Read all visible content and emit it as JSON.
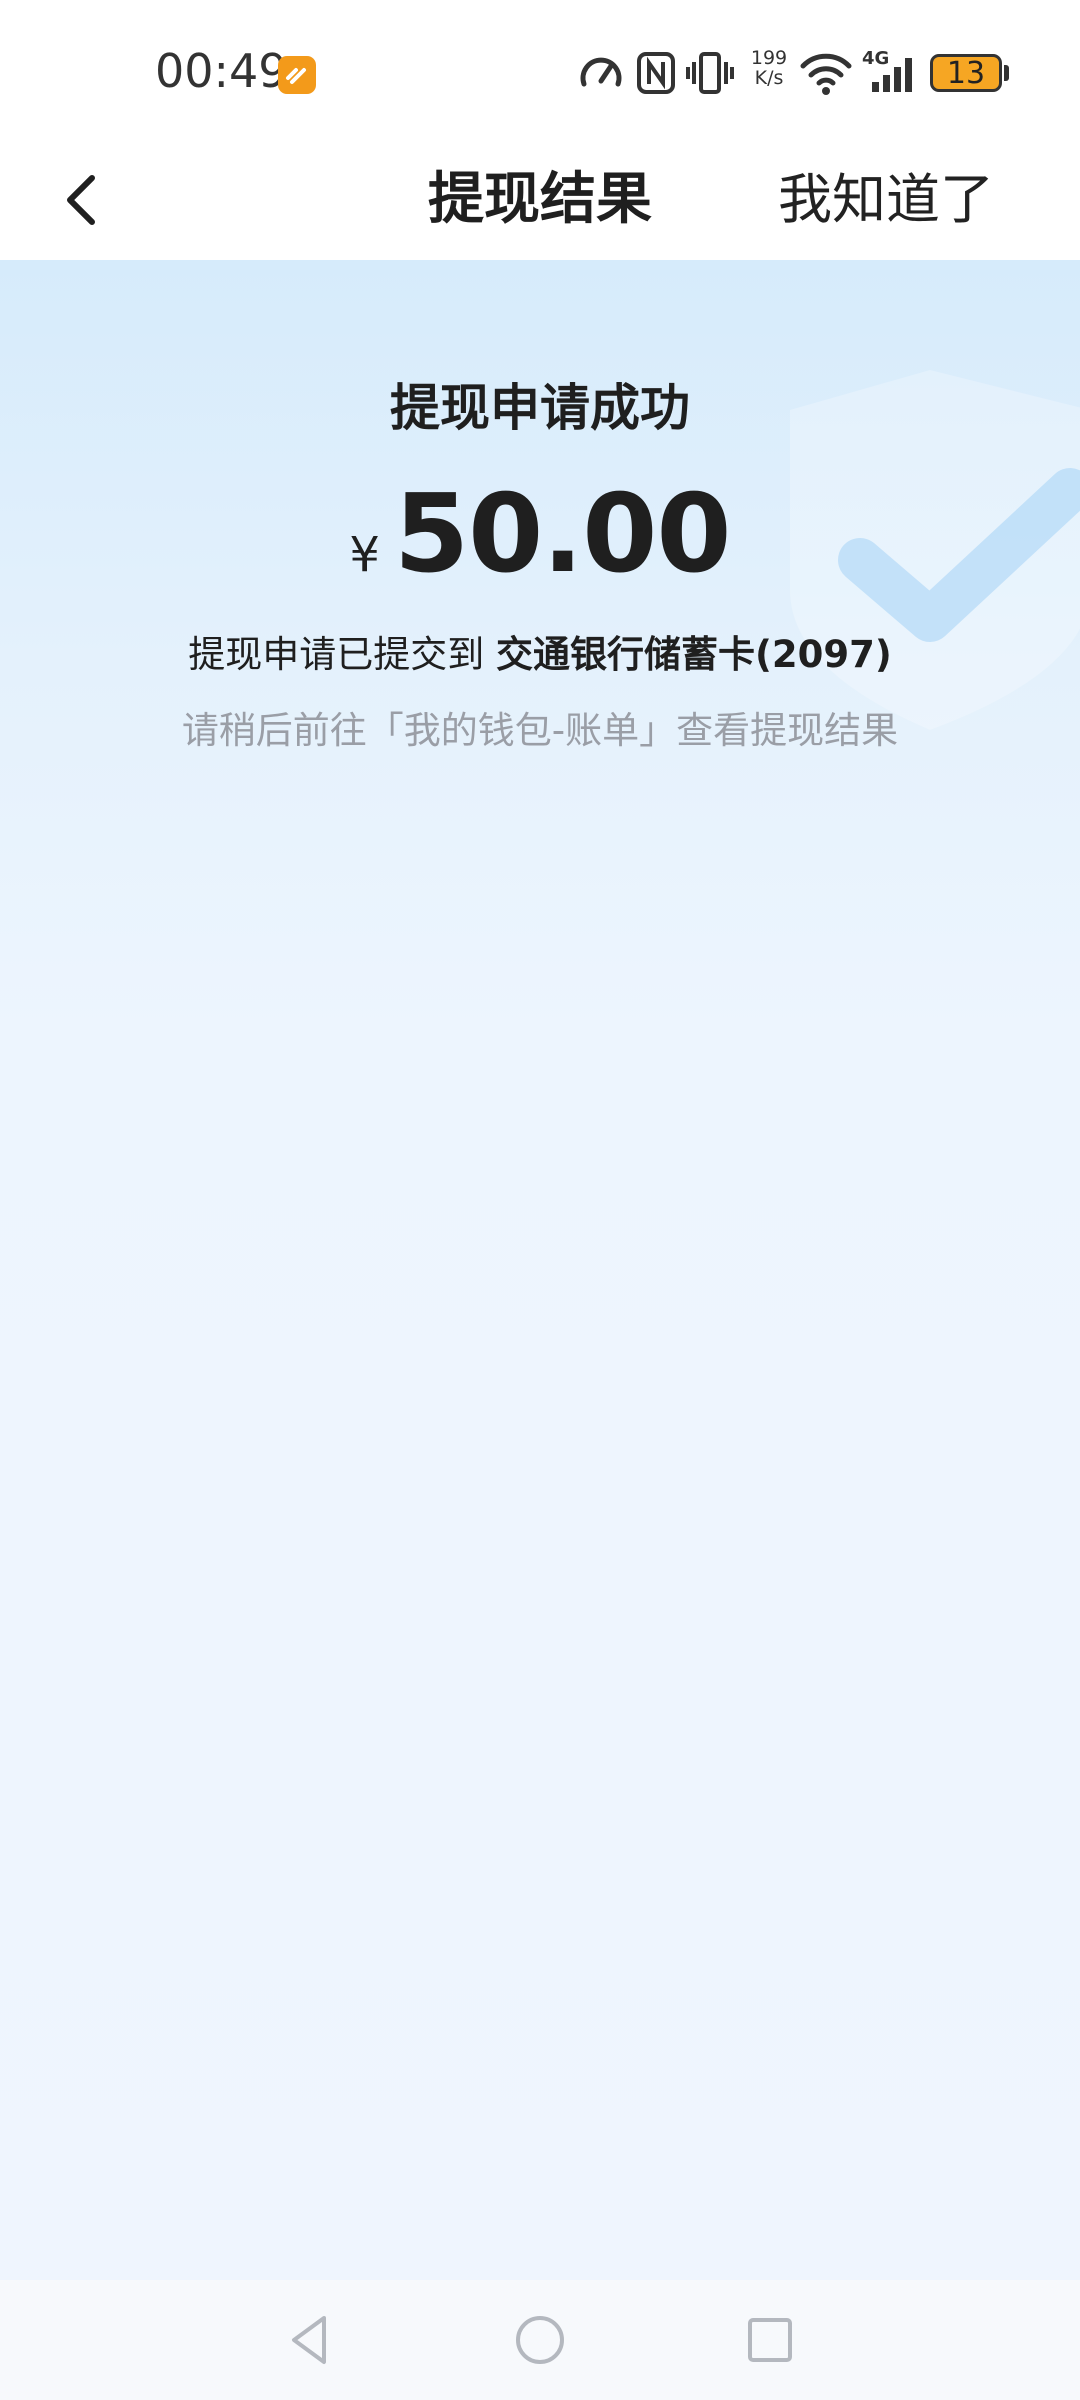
{
  "status_bar": {
    "time": "00:49",
    "net_speed_value": "199",
    "net_speed_unit": "K/s",
    "network": "4G",
    "battery": "13",
    "battery_color": "#f6a623"
  },
  "nav": {
    "title": "提现结果",
    "action_label": "我知道了"
  },
  "result": {
    "title": "提现申请成功",
    "currency": "¥",
    "amount": "50.00",
    "submitted_prefix": "提现申请已提交到",
    "bank": "交通银行储蓄卡(2097)",
    "hint": "请稍后前往「我的钱包-账单」查看提现结果"
  },
  "icons": {
    "back": "chevron-left-icon",
    "watermark": "shield-check-icon"
  }
}
